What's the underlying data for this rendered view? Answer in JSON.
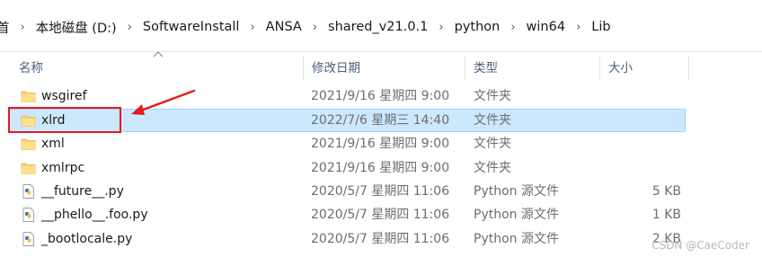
{
  "breadcrumb": {
    "items": [
      "首",
      "本地磁盘 (D:)",
      "SoftwareInstall",
      "ANSA",
      "shared_v21.0.1",
      "python",
      "win64",
      "Lib"
    ],
    "separator": "›"
  },
  "columns": {
    "name": "名称",
    "date": "修改日期",
    "type": "类型",
    "size": "大小"
  },
  "files": [
    {
      "name": "wsgiref",
      "date": "2021/9/16 星期四 9:00",
      "type": "文件夹",
      "size": "",
      "kind": "folder"
    },
    {
      "name": "xlrd",
      "date": "2022/7/6 星期三 14:40",
      "type": "文件夹",
      "size": "",
      "kind": "folder",
      "selected": true
    },
    {
      "name": "xml",
      "date": "2021/9/16 星期四 9:00",
      "type": "文件夹",
      "size": "",
      "kind": "folder"
    },
    {
      "name": "xmlrpc",
      "date": "2021/9/16 星期四 9:00",
      "type": "文件夹",
      "size": "",
      "kind": "folder"
    },
    {
      "name": "__future__.py",
      "date": "2020/5/7 星期四 11:06",
      "type": "Python 源文件",
      "size": "5 KB",
      "kind": "python"
    },
    {
      "name": "__phello__.foo.py",
      "date": "2020/5/7 星期四 11:06",
      "type": "Python 源文件",
      "size": "1 KB",
      "kind": "python"
    },
    {
      "name": "_bootlocale.py",
      "date": "2020/5/7 星期四 11:06",
      "type": "Python 源文件",
      "size": "2 KB",
      "kind": "python"
    }
  ],
  "colors": {
    "selection_bg": "#cce8ff",
    "selection_border": "#99d1ff",
    "annotation_red": "#e21b1b",
    "folder_yellow": "#f8d775"
  },
  "watermark": "CSDN @CaeCoder"
}
